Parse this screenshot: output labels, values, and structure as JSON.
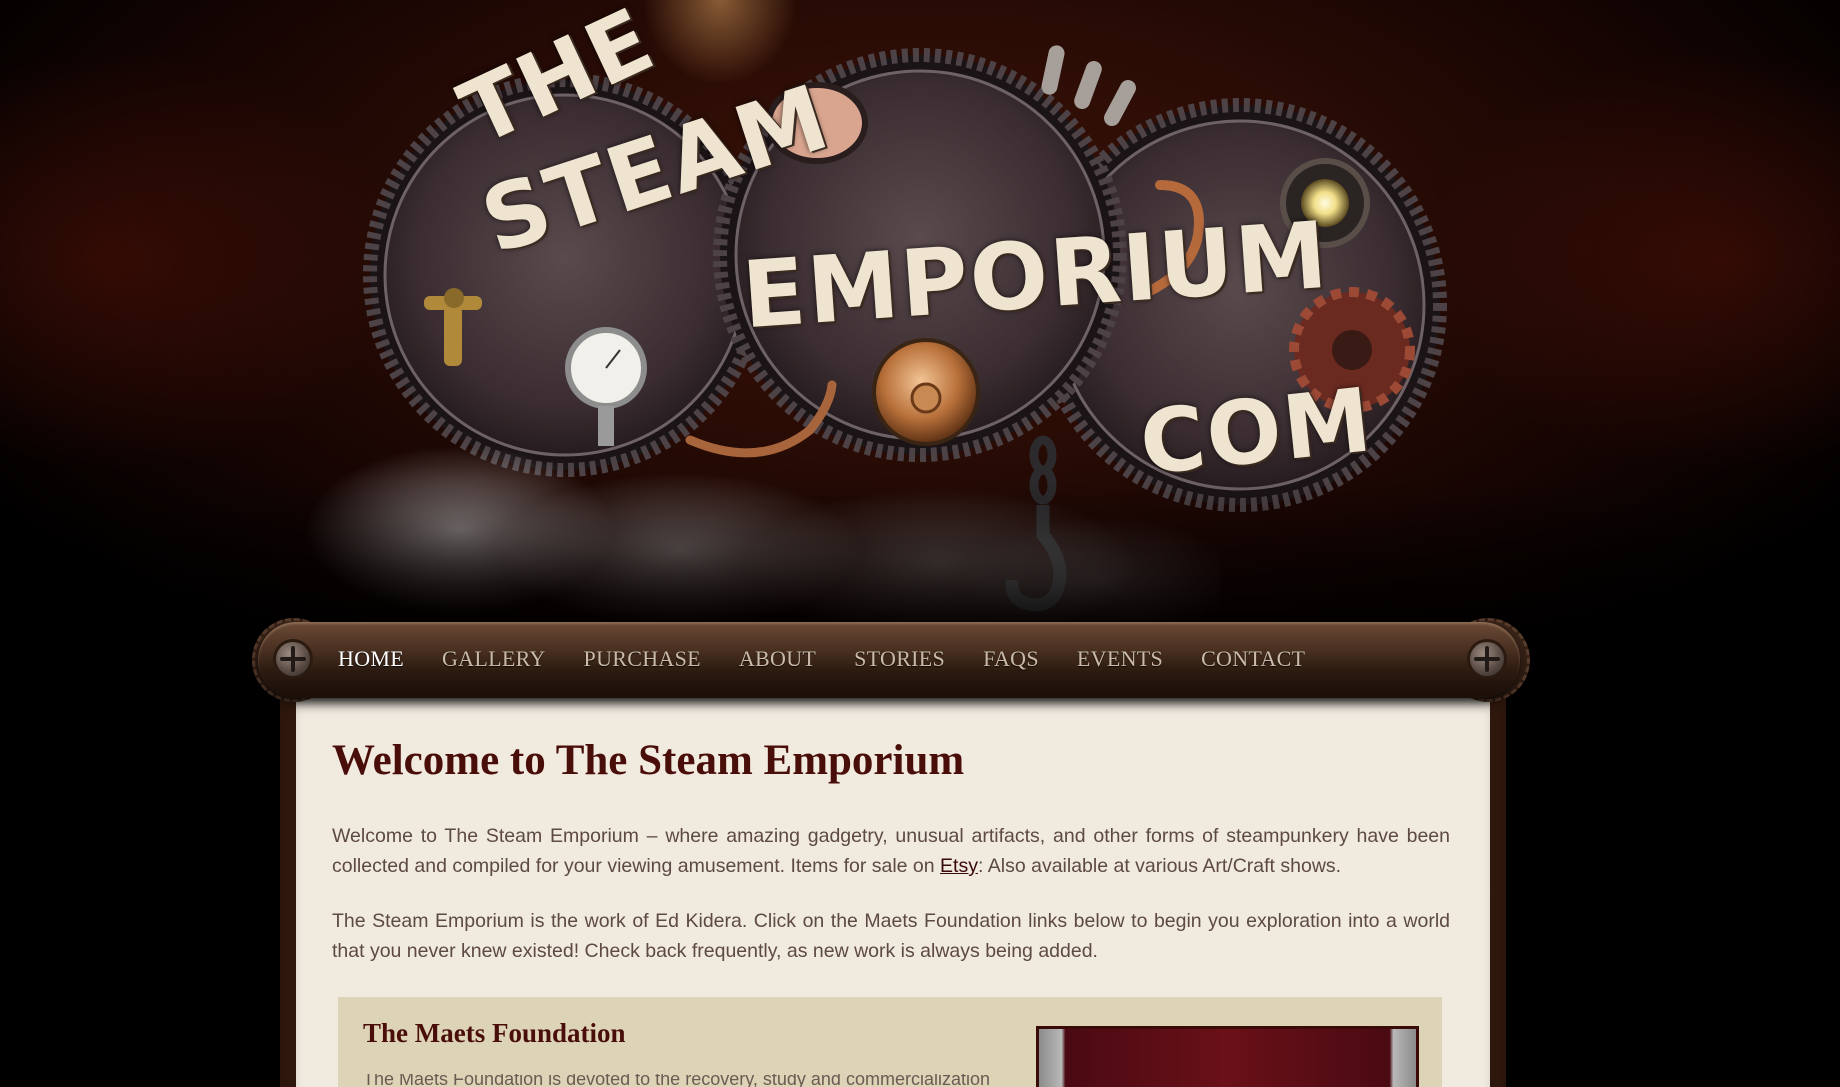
{
  "logo": {
    "word1": "THE",
    "word2": "STEAM",
    "word3": "EMPORIUM",
    "word4": "COM"
  },
  "nav": {
    "items": [
      {
        "label": "HOME",
        "active": true
      },
      {
        "label": "GALLERY",
        "active": false
      },
      {
        "label": "PURCHASE",
        "active": false
      },
      {
        "label": "ABOUT",
        "active": false
      },
      {
        "label": "STORIES",
        "active": false
      },
      {
        "label": "FAQS",
        "active": false
      },
      {
        "label": "EVENTS",
        "active": false
      },
      {
        "label": "CONTACT",
        "active": false
      }
    ]
  },
  "main": {
    "title": "Welcome to The Steam Emporium",
    "p1_before": "Welcome to The Steam Emporium – where amazing gadgetry, unusual artifacts, and other forms of steampunkery have been collected and compiled for your viewing amusement. Items for sale on ",
    "p1_link": "Etsy",
    "p1_after": ":  Also available at various Art/Craft shows.",
    "p2": "The Steam Emporium is the work of Ed Kidera.   Click on the Maets Foundation links below to begin you exploration into a world that you never knew existed! Check back frequently, as new work is always being added.",
    "maets": {
      "title": "The Maets Foundation",
      "text": "The Maets Foundation is devoted to the recovery, study and commercialization"
    }
  },
  "colors": {
    "title": "#4a0e0a",
    "body_text": "#5d4a43",
    "panel_bg": "#f1eadf",
    "maets_bg": "#ddd3b7",
    "nav_active": "#ffffff",
    "nav_inactive": "#c9bba8"
  }
}
